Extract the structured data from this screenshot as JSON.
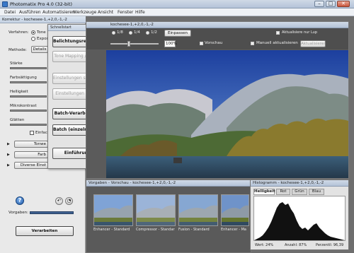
{
  "window": {
    "title": "Photomatix Pro 4.0 (32-bit)"
  },
  "menu": [
    "Datei",
    "Ausführen",
    "Automatisieren",
    "Werkzeuge",
    "Ansicht",
    "Fenster",
    "Hilfe"
  ],
  "left_panel": {
    "header": "Korrektur - kochesee-1,+2,0,-1,-2",
    "verfahren_label": "Verfahren:",
    "verfahren_options": [
      "Tone",
      "Expos"
    ],
    "methode_label": "Methode:",
    "methode_value": "Details",
    "sliders": [
      "Stärke",
      "Farbsättigung",
      "Helligkeit",
      "Mikrokontrast",
      "Glätten"
    ],
    "checkbox_label": "Einfach",
    "expanders": [
      "Tonwe",
      "Farb",
      "Diverse Einst"
    ],
    "vorgaben_label": "Vorgaben:",
    "process_button": "Verarbeiten"
  },
  "quickstart": {
    "title": "Schnellstart",
    "buttons": [
      {
        "label": "Belichtungsreihe laden",
        "enabled": true
      },
      {
        "label": "Tone Mapping / Fusion",
        "enabled": false
      },
      {
        "label": "Einstellungen speichern",
        "enabled": false
      },
      {
        "label": "Einstellungen zeigen",
        "enabled": false
      },
      {
        "label": "Batch-Verarbeitung",
        "enabled": true
      },
      {
        "label": "Batch (einzelne Bilder)",
        "enabled": true
      },
      {
        "label": "Einführung",
        "enabled": true
      }
    ]
  },
  "image_window": {
    "title": "kochesee-1,+2,0,-1,-2",
    "zoom_options": [
      "1/8",
      "1/4",
      "1/2"
    ],
    "fit_button": "Einpassen",
    "auto_update_label": "Aktualisiere nur Lup",
    "zoom_value": "100%",
    "preview_label": "Vorschau",
    "manual_update_label": "Manuell aktualisieren",
    "update_button": "Aktualisieren"
  },
  "presets": {
    "title": "Vorgaben - Vorschau - kochesee-1,+2,0,-1,-2",
    "items": [
      "Enhancer - Standard",
      "Compressor - Standar",
      "Fusion - Standard",
      "Enhancer - Ma"
    ]
  },
  "histogram": {
    "title": "Histogramm - kochesee-1,+2,0,-1,-2",
    "tabs": [
      "Helligkeit",
      "Rot",
      "Grün",
      "Blau"
    ],
    "active_tab": "Helligkeit",
    "footer_wert": "Wert: 24%",
    "footer_anzahl": "Anzahl: 87%",
    "footer_perzentil": "Perzentil: 96,39"
  }
}
